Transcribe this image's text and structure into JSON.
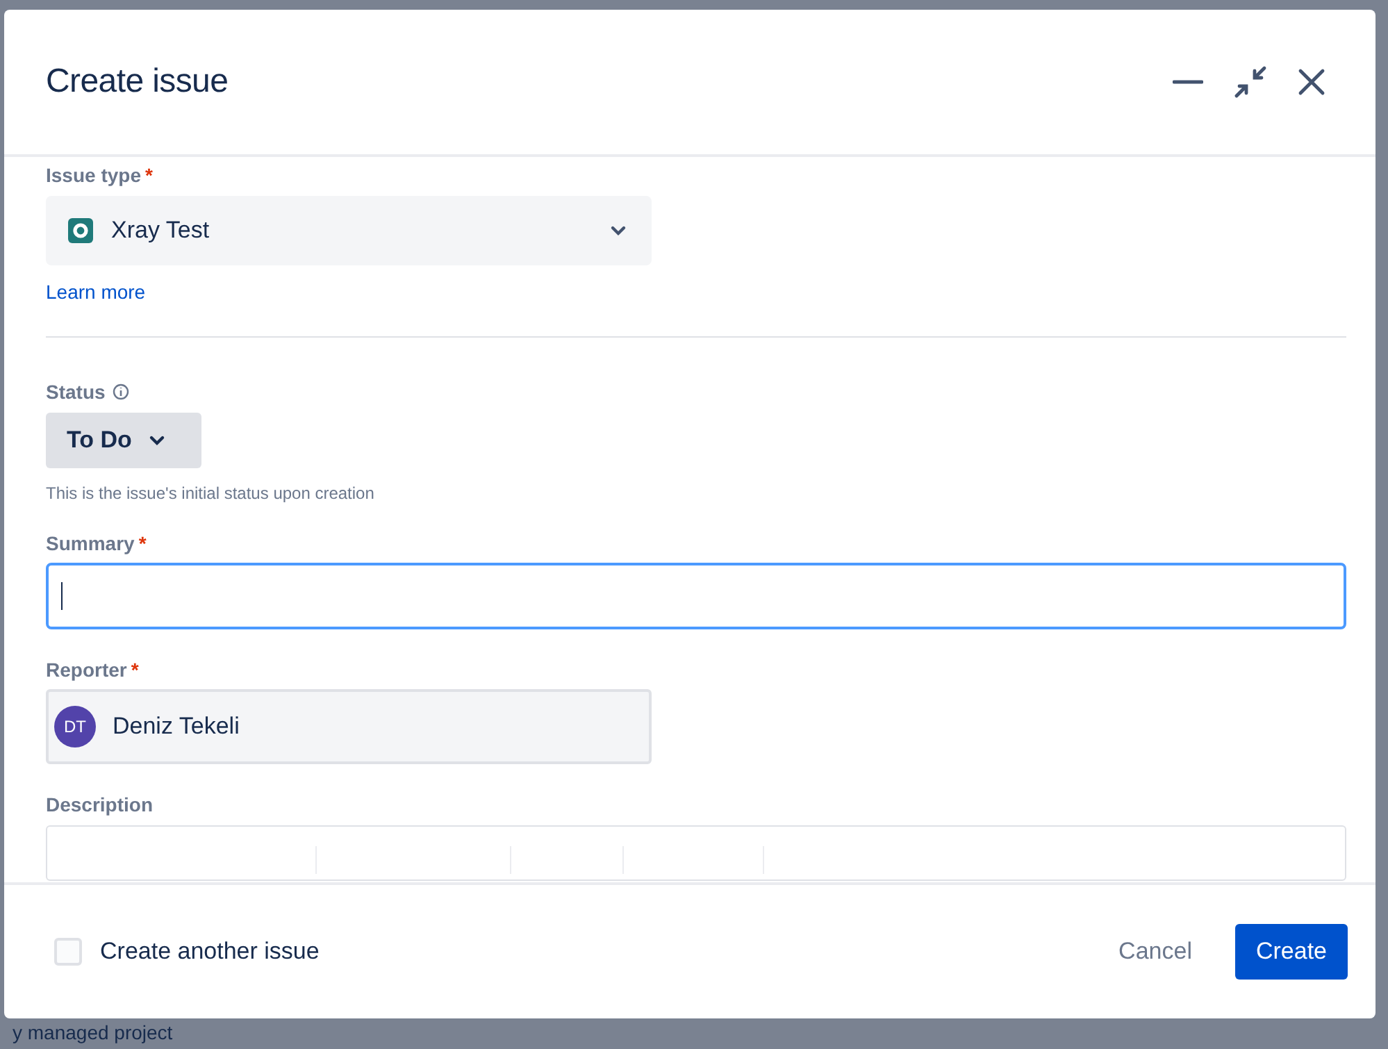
{
  "dialog": {
    "title": "Create issue"
  },
  "issue_type": {
    "label": "Issue type",
    "required_mark": "*",
    "value": "Xray Test",
    "link": "Learn more"
  },
  "status": {
    "label": "Status",
    "value": "To Do",
    "help": "This is the issue's initial status upon creation"
  },
  "summary": {
    "label": "Summary",
    "required_mark": "*",
    "focused": true
  },
  "reporter": {
    "label": "Reporter",
    "required_mark": "*",
    "initials": "DT",
    "name": "Deniz Tekeli"
  },
  "description": {
    "label": "Description"
  },
  "footer": {
    "checkbox": {
      "label": "Create another issue",
      "checked": false
    },
    "cancel": "Cancel",
    "create": "Create"
  },
  "background_text": "y managed project"
}
